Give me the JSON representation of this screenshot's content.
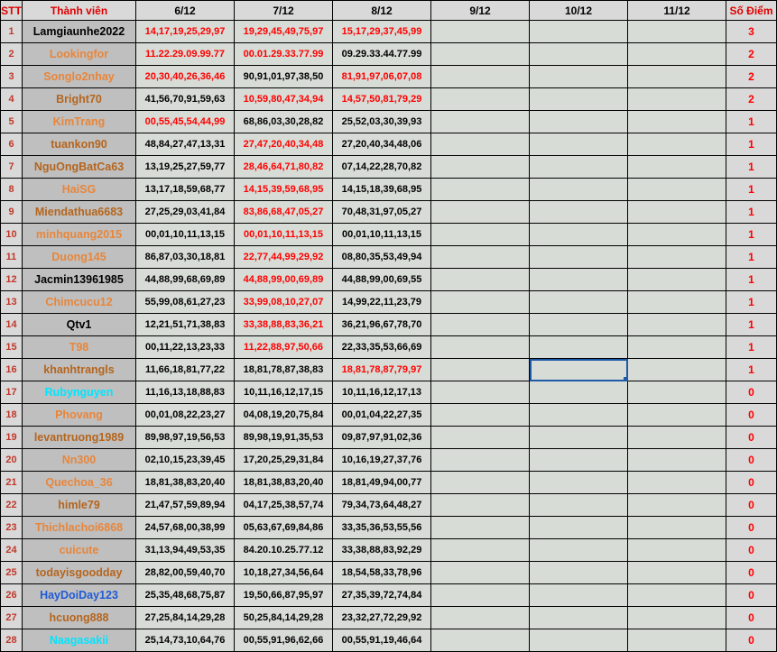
{
  "headers": {
    "stt": "STT",
    "member": "Thành viên",
    "days": [
      "6/12",
      "7/12",
      "8/12",
      "9/12",
      "10/12",
      "11/12"
    ],
    "score": "Số Điểm"
  },
  "colors": {
    "stt_text": "#c0392b",
    "score_text": "#ff0000",
    "cell_bg": "#d7dcd6",
    "selection": "#1e5aa8"
  },
  "selected_cell": {
    "row": 16,
    "column": "10/12"
  },
  "rows": [
    {
      "stt": "1",
      "name": "Lamgiaunhe2022",
      "name_color": "black",
      "d6": "14,17,19,25,29,97",
      "d6c": "red",
      "d7": "19,29,45,49,75,97",
      "d7c": "red",
      "d8": "15,17,29,37,45,99",
      "d8c": "red",
      "score": "3"
    },
    {
      "stt": "2",
      "name": "Lookingfor",
      "name_color": "orange",
      "d6": "11.22.29.09.99.77",
      "d6c": "red",
      "d7": "00.01.29.33.77.99",
      "d7c": "red",
      "d8": "09.29.33.44.77.99",
      "d8c": "black",
      "score": "2"
    },
    {
      "stt": "3",
      "name": "Songlo2nhay",
      "name_color": "orange",
      "d6": "20,30,40,26,36,46",
      "d6c": "red",
      "d7": "90,91,01,97,38,50",
      "d7c": "black",
      "d8": "81,91,97,06,07,08",
      "d8c": "red",
      "score": "2"
    },
    {
      "stt": "4",
      "name": "Bright70",
      "name_color": "brown",
      "d6": "41,56,70,91,59,63",
      "d6c": "black",
      "d7": "10,59,80,47,34,94",
      "d7c": "red",
      "d8": "14,57,50,81,79,29",
      "d8c": "red",
      "score": "2"
    },
    {
      "stt": "5",
      "name": "KimTrang",
      "name_color": "orange",
      "d6": "00,55,45,54,44,99",
      "d6c": "red",
      "d7": "68,86,03,30,28,82",
      "d7c": "black",
      "d8": "25,52,03,30,39,93",
      "d8c": "black",
      "score": "1"
    },
    {
      "stt": "6",
      "name": "tuankon90",
      "name_color": "brown",
      "d6": "48,84,27,47,13,31",
      "d6c": "black",
      "d7": "27,47,20,40,34,48",
      "d7c": "red",
      "d8": "27,20,40,34,48,06",
      "d8c": "black",
      "score": "1"
    },
    {
      "stt": "7",
      "name": "NguOngBatCa63",
      "name_color": "brown",
      "d6": "13,19,25,27,59,77",
      "d6c": "black",
      "d7": "28,46,64,71,80,82",
      "d7c": "red",
      "d8": "07,14,22,28,70,82",
      "d8c": "black",
      "score": "1"
    },
    {
      "stt": "8",
      "name": "HaiSG",
      "name_color": "orange",
      "d6": "13,17,18,59,68,77",
      "d6c": "black",
      "d7": "14,15,39,59,68,95",
      "d7c": "red",
      "d8": "14,15,18,39,68,95",
      "d8c": "black",
      "score": "1"
    },
    {
      "stt": "9",
      "name": "Miendathua6683",
      "name_color": "brown",
      "d6": "27,25,29,03,41,84",
      "d6c": "black",
      "d7": "83,86,68,47,05,27",
      "d7c": "red",
      "d8": "70,48,31,97,05,27",
      "d8c": "black",
      "score": "1"
    },
    {
      "stt": "10",
      "name": "minhquang2015",
      "name_color": "orange",
      "d6": "00,01,10,11,13,15",
      "d6c": "black",
      "d7": "00,01,10,11,13,15",
      "d7c": "red",
      "d8": "00,01,10,11,13,15",
      "d8c": "black",
      "score": "1"
    },
    {
      "stt": "11",
      "name": "Duong145",
      "name_color": "orange",
      "d6": "86,87,03,30,18,81",
      "d6c": "black",
      "d7": "22,77,44,99,29,92",
      "d7c": "red",
      "d8": "08,80,35,53,49,94",
      "d8c": "black",
      "score": "1"
    },
    {
      "stt": "12",
      "name": "Jacmin13961985",
      "name_color": "black",
      "d6": "44,88,99,68,69,89",
      "d6c": "black",
      "d7": "44,88,99,00,69,89",
      "d7c": "red",
      "d8": "44,88,99,00,69,55",
      "d8c": "black",
      "score": "1"
    },
    {
      "stt": "13",
      "name": "Chimcucu12",
      "name_color": "orange",
      "d6": "55,99,08,61,27,23",
      "d6c": "black",
      "d7": "33,99,08,10,27,07",
      "d7c": "red",
      "d8": "14,99,22,11,23,79",
      "d8c": "black",
      "score": "1"
    },
    {
      "stt": "14",
      "name": "Qtv1",
      "name_color": "black",
      "d6": "12,21,51,71,38,83",
      "d6c": "black",
      "d7": "33,38,88,83,36,21",
      "d7c": "red",
      "d8": "36,21,96,67,78,70",
      "d8c": "black",
      "score": "1"
    },
    {
      "stt": "15",
      "name": "T98",
      "name_color": "orange",
      "d6": "00,11,22,13,23,33",
      "d6c": "black",
      "d7": "11,22,88,97,50,66",
      "d7c": "red",
      "d8": "22,33,35,53,66,69",
      "d8c": "black",
      "score": "1"
    },
    {
      "stt": "16",
      "name": "khanhtrangls",
      "name_color": "brown",
      "d6": "11,66,18,81,77,22",
      "d6c": "black",
      "d7": "18,81,78,87,38,83",
      "d7c": "black",
      "d8": "18,81,78,87,79,97",
      "d8c": "red",
      "score": "1"
    },
    {
      "stt": "17",
      "name": "Rubynguyen",
      "name_color": "cyan",
      "d6": "11,16,13,18,88,83",
      "d6c": "black",
      "d7": "10,11,16,12,17,15",
      "d7c": "black",
      "d8": "10,11,16,12,17,13",
      "d8c": "black",
      "score": "0"
    },
    {
      "stt": "18",
      "name": "Phovang",
      "name_color": "orange",
      "d6": "00,01,08,22,23,27",
      "d6c": "black",
      "d7": "04,08,19,20,75,84",
      "d7c": "black",
      "d8": "00,01,04,22,27,35",
      "d8c": "black",
      "score": "0"
    },
    {
      "stt": "19",
      "name": "levantruong1989",
      "name_color": "brown",
      "d6": "89,98,97,19,56,53",
      "d6c": "black",
      "d7": "89,98,19,91,35,53",
      "d7c": "black",
      "d8": "09,87,97,91,02,36",
      "d8c": "black",
      "score": "0"
    },
    {
      "stt": "20",
      "name": "Nn300",
      "name_color": "orange",
      "d6": "02,10,15,23,39,45",
      "d6c": "black",
      "d7": "17,20,25,29,31,84",
      "d7c": "black",
      "d8": "10,16,19,27,37,76",
      "d8c": "black",
      "score": "0"
    },
    {
      "stt": "21",
      "name": "Quechoa_36",
      "name_color": "orange",
      "d6": "18,81,38,83,20,40",
      "d6c": "black",
      "d7": "18,81,38,83,20,40",
      "d7c": "black",
      "d8": "18,81,49,94,00,77",
      "d8c": "black",
      "score": "0"
    },
    {
      "stt": "22",
      "name": "himle79",
      "name_color": "brown",
      "d6": "21,47,57,59,89,94",
      "d6c": "black",
      "d7": "04,17,25,38,57,74",
      "d7c": "black",
      "d8": "79,34,73,64,48,27",
      "d8c": "black",
      "score": "0"
    },
    {
      "stt": "23",
      "name": "Thichlachoi6868",
      "name_color": "orange",
      "d6": "24,57,68,00,38,99",
      "d6c": "black",
      "d7": "05,63,67,69,84,86",
      "d7c": "black",
      "d8": "33,35,36,53,55,56",
      "d8c": "black",
      "score": "0"
    },
    {
      "stt": "24",
      "name": "cuicute",
      "name_color": "orange",
      "d6": "31,13,94,49,53,35",
      "d6c": "black",
      "d7": "84.20.10.25.77.12",
      "d7c": "black",
      "d8": "33,38,88,83,92,29",
      "d8c": "black",
      "score": "0"
    },
    {
      "stt": "25",
      "name": "todayisgoodday",
      "name_color": "brown",
      "d6": "28,82,00,59,40,70",
      "d6c": "black",
      "d7": "10,18,27,34,56,64",
      "d7c": "black",
      "d8": "18,54,58,33,78,96",
      "d8c": "black",
      "score": "0"
    },
    {
      "stt": "26",
      "name": "HayDoiDay123",
      "name_color": "blue",
      "d6": "25,35,48,68,75,87",
      "d6c": "black",
      "d7": "19,50,66,87,95,97",
      "d7c": "black",
      "d8": "27,35,39,72,74,84",
      "d8c": "black",
      "score": "0"
    },
    {
      "stt": "27",
      "name": "hcuong888",
      "name_color": "brown",
      "d6": "27,25,84,14,29,28",
      "d6c": "black",
      "d7": "50,25,84,14,29,28",
      "d7c": "black",
      "d8": "23,32,27,72,29,92",
      "d8c": "black",
      "score": "0"
    },
    {
      "stt": "28",
      "name": "Naagasakii",
      "name_color": "cyan",
      "d6": "25,14,73,10,64,76",
      "d6c": "black",
      "d7": "00,55,91,96,62,66",
      "d7c": "black",
      "d8": "00,55,91,19,46,64",
      "d8c": "black",
      "score": "0"
    }
  ]
}
